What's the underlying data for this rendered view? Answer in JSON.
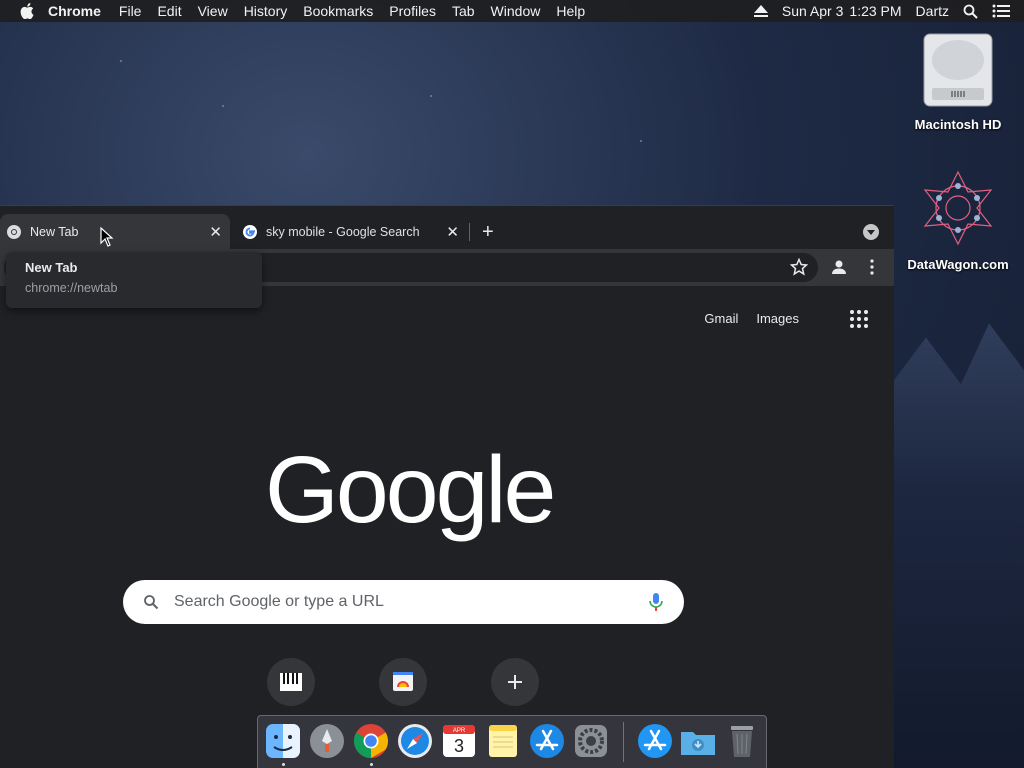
{
  "menubar": {
    "app_name": "Chrome",
    "items": [
      "File",
      "Edit",
      "View",
      "History",
      "Bookmarks",
      "Profiles",
      "Tab",
      "Window",
      "Help"
    ],
    "date": "Sun Apr 3",
    "time": "1:23 PM",
    "user": "Dartz"
  },
  "desktop": {
    "icons": [
      {
        "label": "Macintosh HD",
        "icon": "hard-drive-icon"
      },
      {
        "label": "DataWagon.com",
        "icon": "datawagon-logo-icon"
      }
    ]
  },
  "browser": {
    "tabs": [
      {
        "title": "New Tab",
        "active": true,
        "icon": "chrome-icon"
      },
      {
        "title": "sky mobile - Google Search",
        "active": false,
        "icon": "google-g-icon"
      }
    ],
    "tooltip": {
      "title": "New Tab",
      "url": "chrome://newtab"
    },
    "page": {
      "links": [
        "Gmail",
        "Images"
      ],
      "logo": "Google",
      "search_placeholder": "Search Google or type a URL",
      "shortcuts": [
        "piano-shortcut-icon",
        "photos-shortcut-icon",
        "add-shortcut-icon"
      ]
    }
  },
  "dock": {
    "apps": [
      "Finder",
      "Launchpad",
      "Google Chrome",
      "Safari",
      "Calendar",
      "Notes",
      "App Store",
      "System Preferences",
      "App Store",
      "Downloads",
      "Trash"
    ],
    "calendar": {
      "month": "APR",
      "day": "3"
    }
  },
  "colors": {
    "chrome_bg": "#202124",
    "tab_active": "#35363a",
    "desktop_bg": "#1e2a45"
  }
}
